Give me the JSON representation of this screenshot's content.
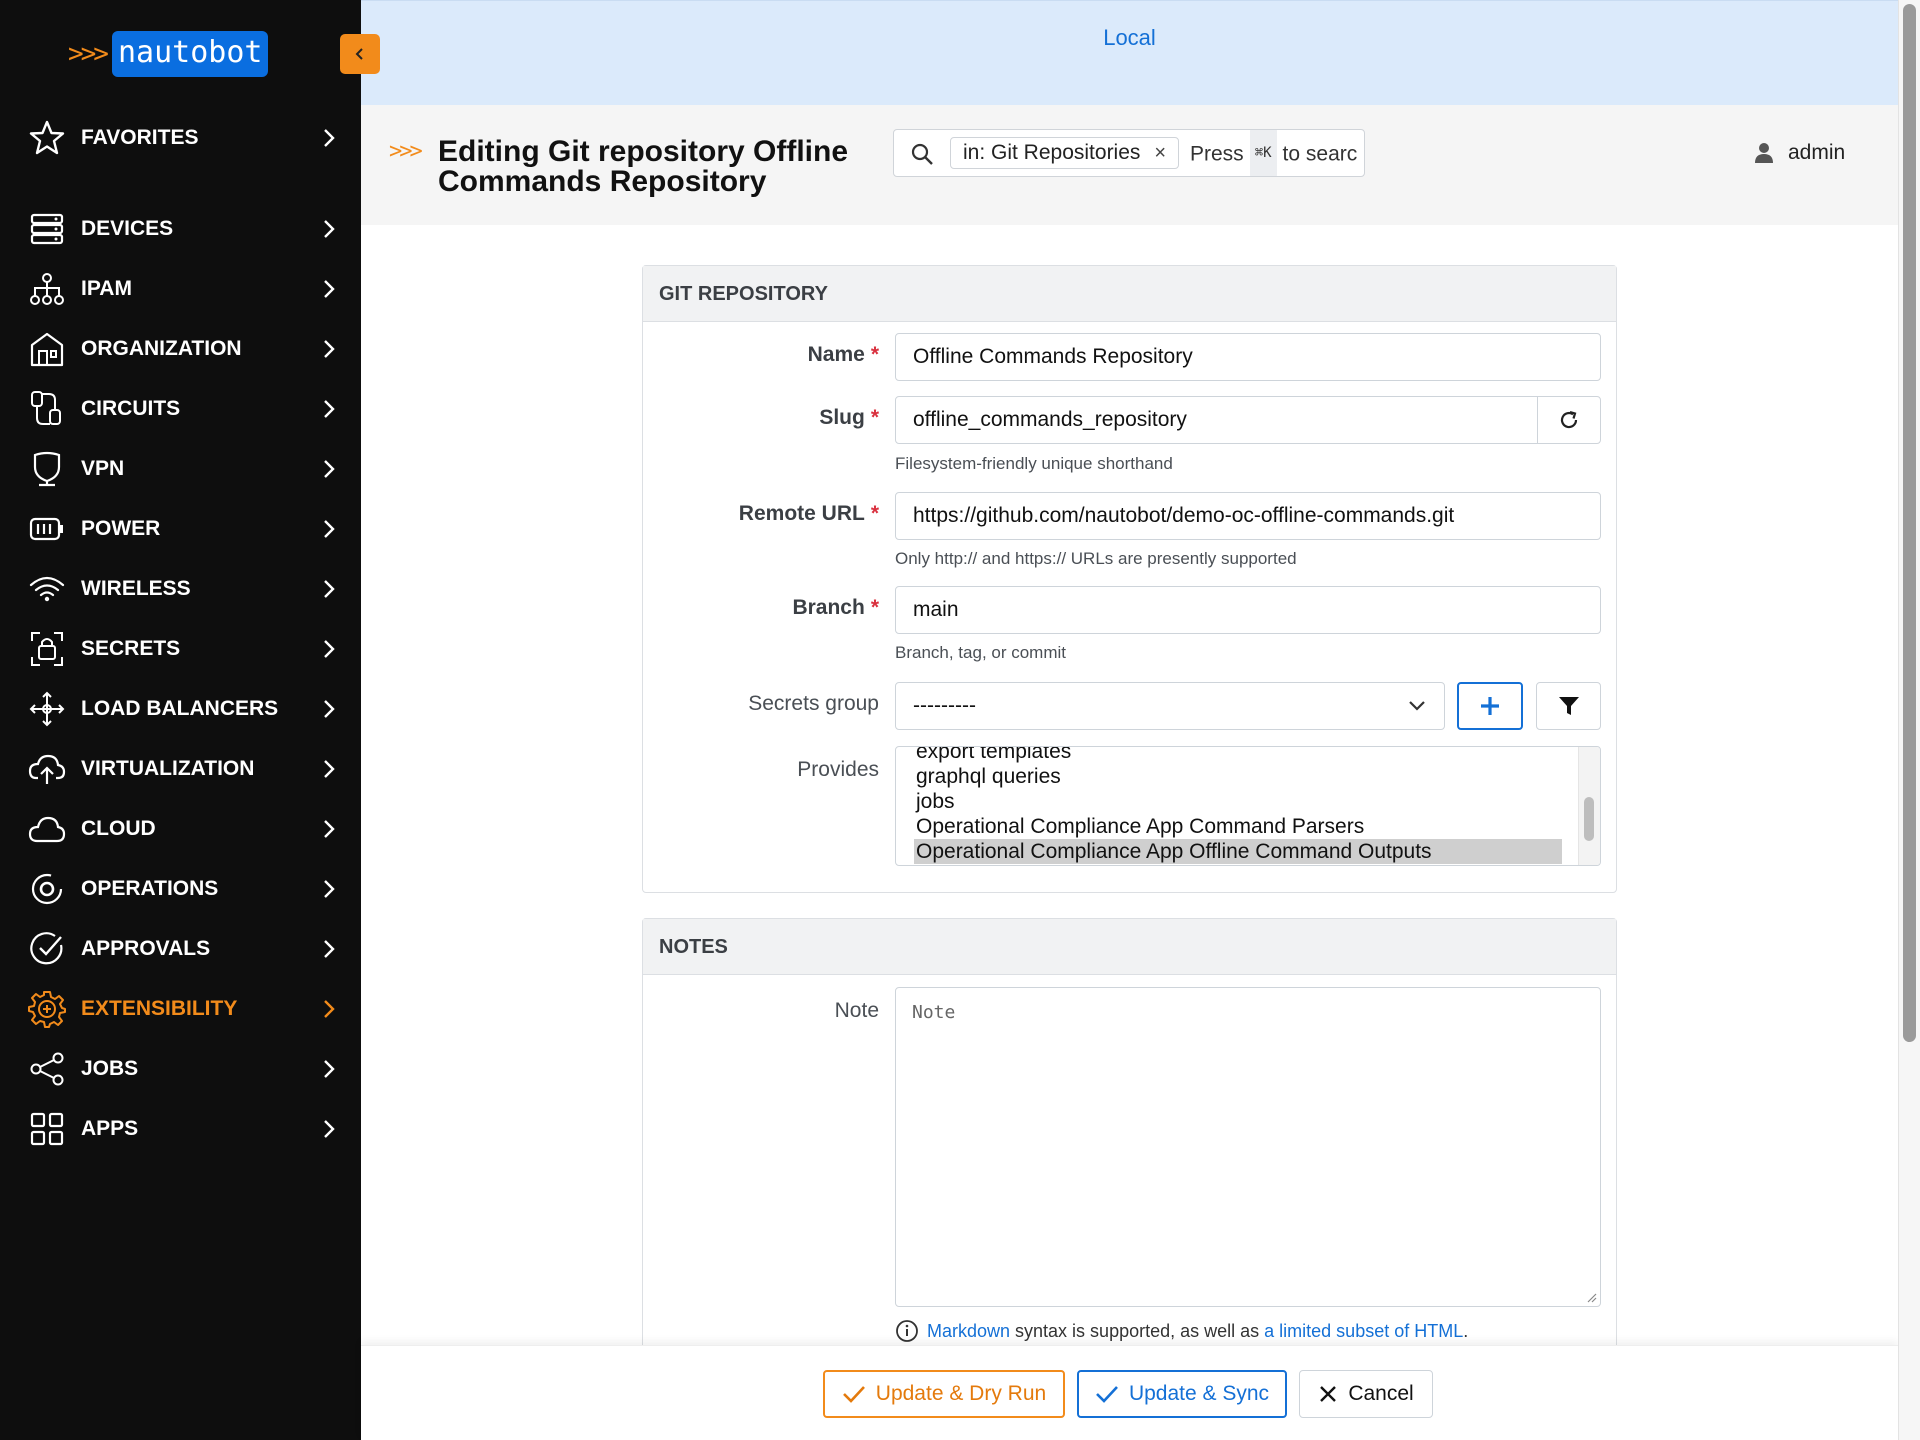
{
  "brand": {
    "chevrons": ">>>",
    "wordmark": "nautobot",
    "accent": "#f28b1b",
    "blue": "#1470d6"
  },
  "sidebar": {
    "items": [
      {
        "label": "FAVORITES",
        "icon": "star-icon"
      },
      {
        "label": "DEVICES",
        "icon": "server-icon"
      },
      {
        "label": "IPAM",
        "icon": "network-tree-icon"
      },
      {
        "label": "ORGANIZATION",
        "icon": "building-icon"
      },
      {
        "label": "CIRCUITS",
        "icon": "circuit-plug-icon"
      },
      {
        "label": "VPN",
        "icon": "shield-icon"
      },
      {
        "label": "POWER",
        "icon": "battery-icon"
      },
      {
        "label": "WIRELESS",
        "icon": "wifi-icon"
      },
      {
        "label": "SECRETS",
        "icon": "lock-icon"
      },
      {
        "label": "LOAD BALANCERS",
        "icon": "arrows-move-icon"
      },
      {
        "label": "VIRTUALIZATION",
        "icon": "cloud-upload-icon"
      },
      {
        "label": "CLOUD",
        "icon": "cloud-icon"
      },
      {
        "label": "OPERATIONS",
        "icon": "target-icon"
      },
      {
        "label": "APPROVALS",
        "icon": "check-circle-icon"
      },
      {
        "label": "EXTENSIBILITY",
        "icon": "gear-icon",
        "active": true
      },
      {
        "label": "JOBS",
        "icon": "workflow-icon"
      },
      {
        "label": "APPS",
        "icon": "grid-icon"
      }
    ]
  },
  "banner": {
    "environment": "Local"
  },
  "header": {
    "chevrons": ">>>",
    "title": "Editing Git repository Offline Commands Repository",
    "search": {
      "scope_chip": "in: Git Repositories",
      "hint_before": "Press",
      "shortcut": "⌘K",
      "hint_after": "to searc"
    },
    "user": "admin"
  },
  "git_panel": {
    "heading": "Git Repository",
    "name": {
      "label": "Name",
      "value": "Offline Commands Repository"
    },
    "slug": {
      "label": "Slug",
      "value": "offline_commands_repository",
      "help": "Filesystem-friendly unique shorthand"
    },
    "remote_url": {
      "label": "Remote URL",
      "value": "https://github.com/nautobot/demo-oc-offline-commands.git",
      "help": "Only http:// and https:// URLs are presently supported"
    },
    "branch": {
      "label": "Branch",
      "value": "main",
      "help": "Branch, tag, or commit"
    },
    "secrets_group": {
      "label": "Secrets group",
      "value": "---------"
    },
    "provides": {
      "label": "Provides",
      "options": [
        "export templates",
        "graphql queries",
        "jobs",
        "Operational Compliance App Command Parsers",
        "Operational Compliance App Offline Command Outputs"
      ],
      "selected": "Operational Compliance App Offline Command Outputs"
    }
  },
  "notes_panel": {
    "heading": "Notes",
    "note": {
      "label": "Note",
      "placeholder": "Note"
    },
    "help": {
      "link1": "Markdown",
      "middle": " syntax is supported, as well as ",
      "link2": "a limited subset of HTML",
      "end": "."
    }
  },
  "footer": {
    "dry_run": "Update & Dry Run",
    "sync": "Update & Sync",
    "cancel": "Cancel"
  }
}
